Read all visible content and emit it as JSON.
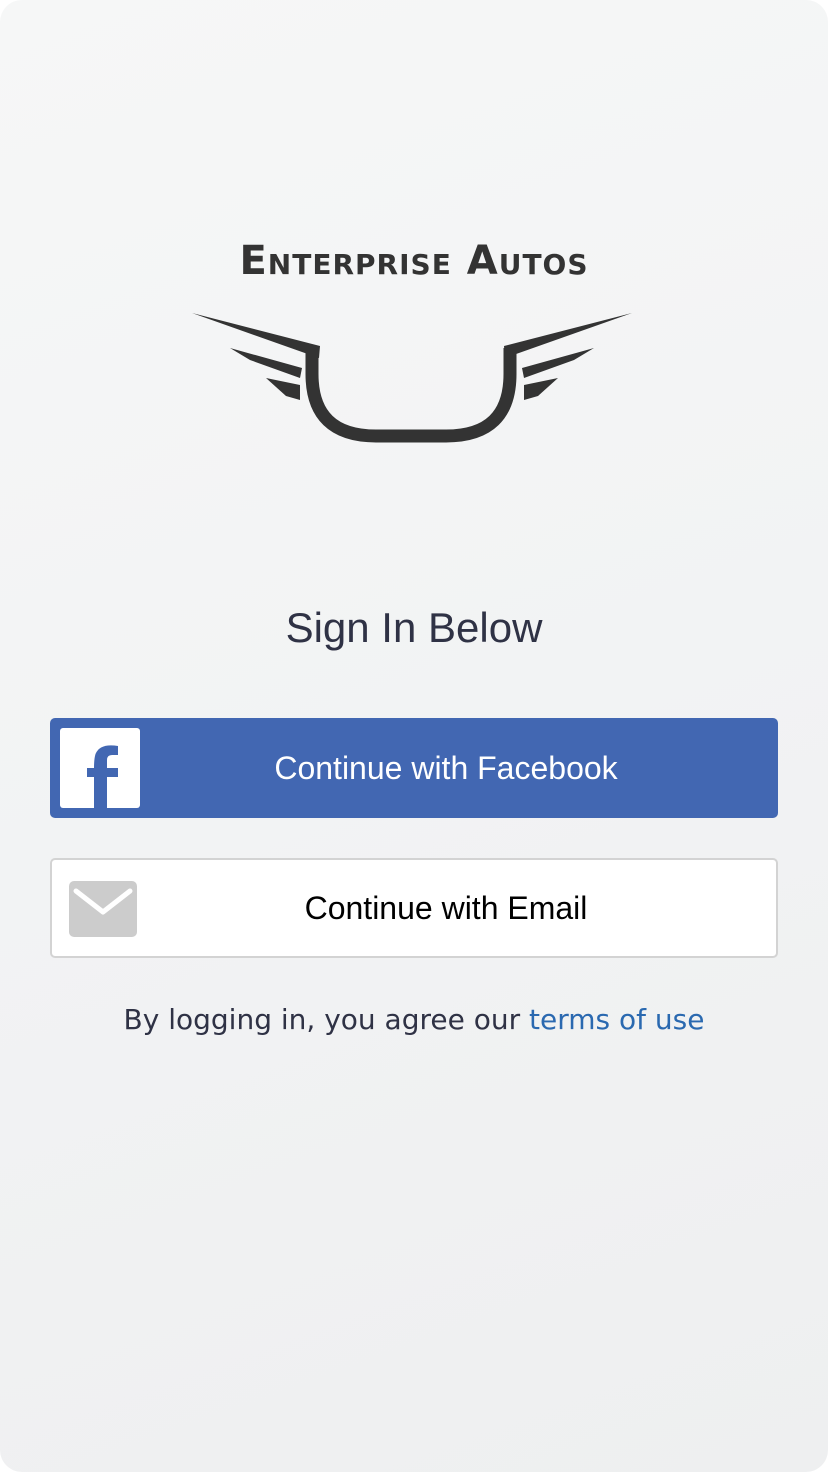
{
  "brand": {
    "name": "Enterprise Autos"
  },
  "heading": "Sign In Below",
  "buttons": {
    "facebook": {
      "label": "Continue with Facebook",
      "icon": "facebook-icon"
    },
    "email": {
      "label": "Continue with Email",
      "icon": "envelope-icon"
    }
  },
  "terms": {
    "prefix": "By logging in, you agree our ",
    "link_label": "terms of use"
  },
  "colors": {
    "facebook": "#4267b2",
    "link": "#2a69b0",
    "text": "#2f3245",
    "logo": "#333333"
  }
}
